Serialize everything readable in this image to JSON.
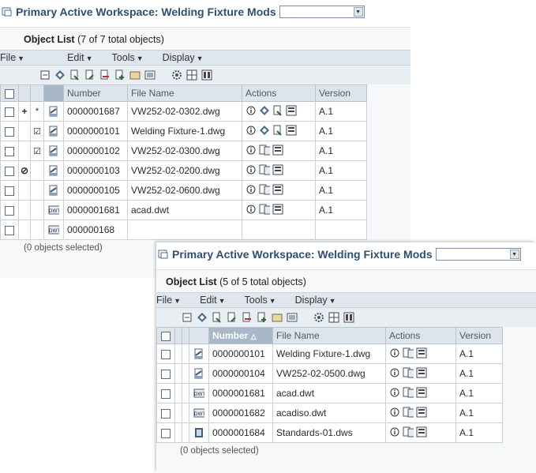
{
  "windows": [
    {
      "title": "Primary Active Workspace: Welding Fixture Mods",
      "object_list_label": "Object List",
      "object_list_count": "(7 of 7 total objects)",
      "menus": [
        "File",
        "Edit",
        "Tools",
        "Display"
      ],
      "columns": [
        "Number",
        "File Name",
        "Actions",
        "Version"
      ],
      "rows": [
        {
          "mark1": "+",
          "mark2": "*",
          "doc": "drawing-icon",
          "number": "0000001687",
          "file": "VW252-02-0302.dwg",
          "version": "A.1"
        },
        {
          "mark1": "",
          "mark2": "☑",
          "doc": "drawing-icon",
          "number": "0000000101",
          "file": "Welding Fixture-1.dwg",
          "version": "A.1"
        },
        {
          "mark1": "",
          "mark2": "☑",
          "doc": "drawing-icon",
          "number": "0000000102",
          "file": "VW252-02-0300.dwg",
          "version": "A.1"
        },
        {
          "mark1": "⊘",
          "mark2": "",
          "doc": "drawing-icon",
          "number": "0000000103",
          "file": "VW252-02-0200.dwg",
          "version": "A.1"
        },
        {
          "mark1": "",
          "mark2": "",
          "doc": "drawing-icon",
          "number": "0000000105",
          "file": "VW252-02-0600.dwg",
          "version": "A.1"
        },
        {
          "mark1": "",
          "mark2": "",
          "doc": "dwt-icon",
          "number": "0000001681",
          "file": "acad.dwt",
          "version": "A.1"
        },
        {
          "mark1": "",
          "mark2": "",
          "doc": "dwt-icon",
          "number": "000000168",
          "file": "",
          "version": ""
        }
      ],
      "footer": "(0 objects selected)"
    },
    {
      "title": "Primary Active Workspace: Welding Fixture Mods",
      "object_list_label": "Object List",
      "object_list_count": "(5 of 5 total objects)",
      "menus": [
        "File",
        "Edit",
        "Tools",
        "Display"
      ],
      "columns": [
        "Number",
        "File Name",
        "Actions",
        "Version"
      ],
      "rows": [
        {
          "doc": "drawing-icon",
          "number": "0000000101",
          "file": "Welding Fixture-1.dwg",
          "version": "A.1"
        },
        {
          "doc": "drawing-icon",
          "number": "0000000104",
          "file": "VW252-02-0500.dwg",
          "version": "A.1"
        },
        {
          "doc": "dwt-icon",
          "number": "0000001681",
          "file": "acad.dwt",
          "version": "A.1"
        },
        {
          "doc": "dwt-icon",
          "number": "0000001682",
          "file": "acadiso.dwt",
          "version": "A.1"
        },
        {
          "doc": "dws-icon",
          "number": "0000001684",
          "file": "Standards-01.dws",
          "version": "A.1"
        }
      ],
      "footer": "(0 objects selected)"
    }
  ]
}
